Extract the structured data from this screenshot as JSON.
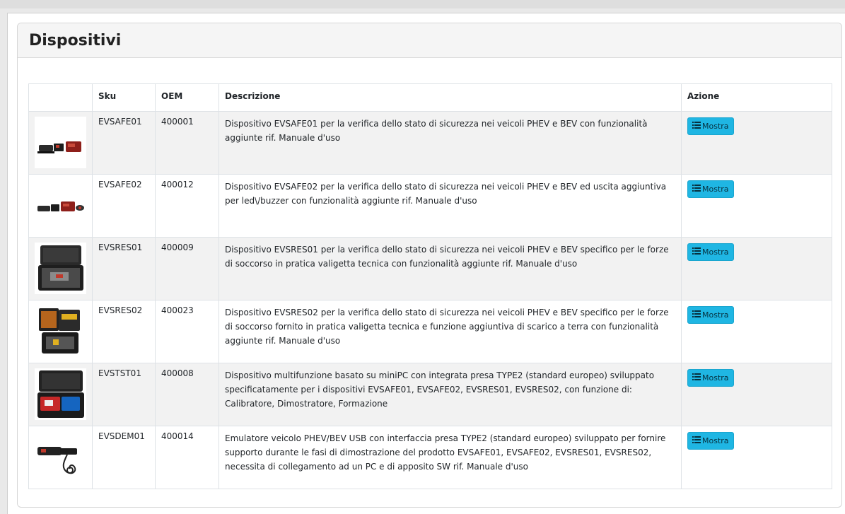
{
  "page": {
    "title": "Dispositivi"
  },
  "table": {
    "headers": {
      "image": "",
      "sku": "Sku",
      "oem": "OEM",
      "description": "Descrizione",
      "action": "Azione"
    },
    "rows": [
      {
        "sku": "EVSAFE01",
        "oem": "400001",
        "description": "Dispositivo EVSAFE01 per la verifica dello stato di sicurezza nei veicoli PHEV e BEV con funzionalità aggiunte rif. Manuale d'uso",
        "image": "evsafe01-device-photo",
        "action_label": "Mostra",
        "action_icon": "list-icon"
      },
      {
        "sku": "EVSAFE02",
        "oem": "400012",
        "description": "Dispositivo EVSAFE02 per la verifica dello stato di sicurezza nei veicoli PHEV e BEV ed uscita aggiuntiva per led\\/buzzer con funzionalità aggiunte rif. Manuale d'uso",
        "image": "evsafe02-device-photo",
        "action_label": "Mostra",
        "action_icon": "list-icon"
      },
      {
        "sku": "EVSRES01",
        "oem": "400009",
        "description": "Dispositivo EVSRES01 per la verifica dello stato di sicurezza nei veicoli PHEV e BEV specifico per le forze di soccorso in pratica valigetta tecnica con funzionalità aggiunte rif. Manuale d'uso",
        "image": "evsres01-case-photo",
        "action_label": "Mostra",
        "action_icon": "list-icon"
      },
      {
        "sku": "EVSRES02",
        "oem": "400023",
        "description": "Dispositivo EVSRES02 per la verifica dello stato di sicurezza nei veicoli PHEV e BEV specifico per le forze di soccorso fornito in pratica valigetta tecnica e funzione aggiuntiva di scarico a terra con funzionalità aggiunte rif. Manuale d'uso",
        "image": "evsres02-case-photo",
        "action_label": "Mostra",
        "action_icon": "list-icon"
      },
      {
        "sku": "EVSTST01",
        "oem": "400008",
        "description": "Dispositivo multifunzione basato su miniPC con integrata presa TYPE2 (standard europeo) sviluppato specificatamente per i dispositivi EVSAFE01, EVSAFE02, EVSRES01, EVSRES02, con funzione di: Calibratore, Dimostratore, Formazione",
        "image": "evstst01-case-photo",
        "action_label": "Mostra",
        "action_icon": "list-icon"
      },
      {
        "sku": "EVSDEM01",
        "oem": "400014",
        "description": "Emulatore veicolo PHEV/BEV USB con interfaccia presa TYPE2 (standard europeo) sviluppato per fornire supporto durante le fasi di dimostrazione del prodotto EVSAFE01, EVSAFE02, EVSRES01, EVSRES02, necessita di collegamento ad un PC e di apposito SW rif. Manuale d'uso",
        "image": "evsdem01-device-photo",
        "action_label": "Mostra",
        "action_icon": "list-icon"
      }
    ]
  },
  "colors": {
    "button_bg": "#1fb6e3",
    "row_stripe": "#f2f2f2",
    "header_bg": "#f5f5f5"
  }
}
